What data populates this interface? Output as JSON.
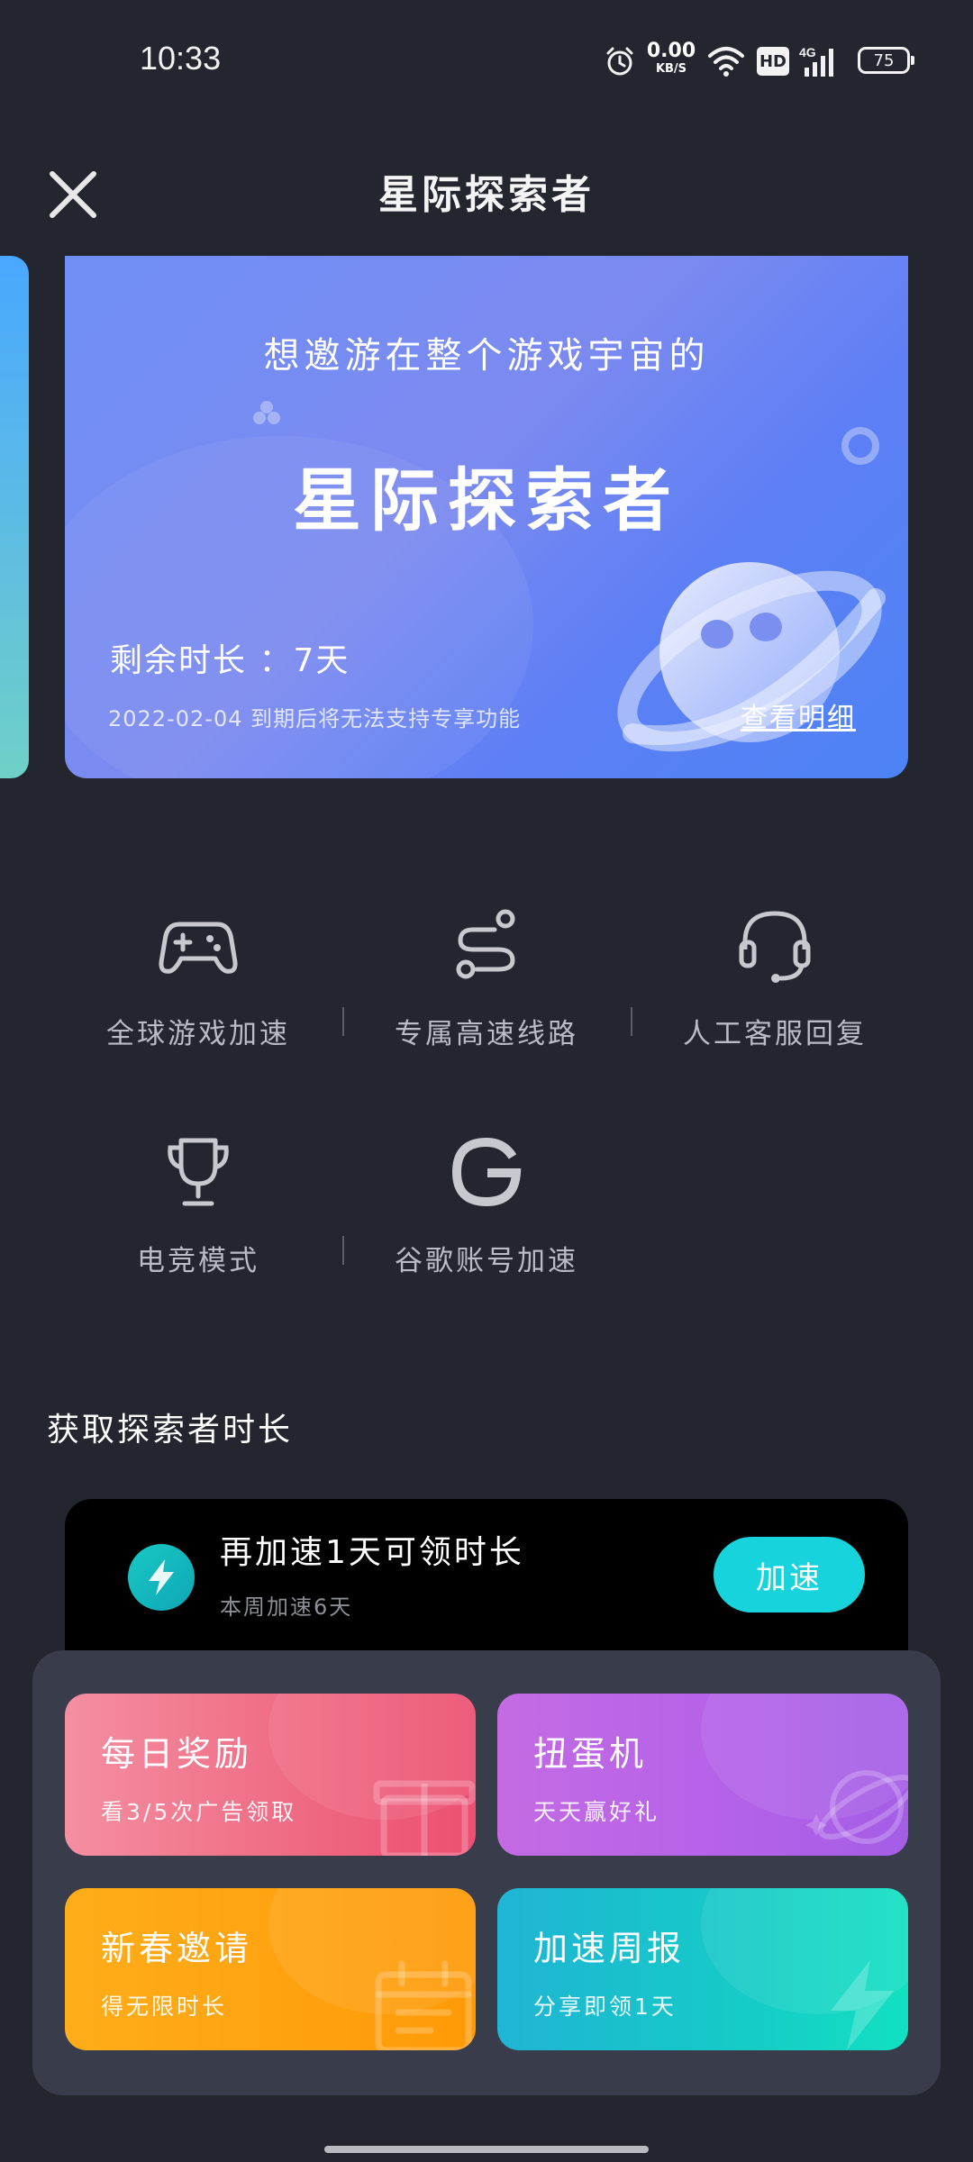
{
  "status_bar": {
    "time": "10:33",
    "net_speed_value": "0.00",
    "net_speed_unit": "KB/S",
    "hd": "HD",
    "signal_label": "4G",
    "battery": "75",
    "icons": [
      "alarm-icon",
      "wifi-icon",
      "hd-icon",
      "signal-icon",
      "battery-icon"
    ]
  },
  "header": {
    "title": "星际探索者",
    "close_icon": "close-icon"
  },
  "hero": {
    "subtitle": "想邀游在整个游戏宇宙的",
    "title": "星际探索者",
    "remaining": "剩余时长 ：7天",
    "expiry_note": "2022-02-04 到期后将无法支持专享功能",
    "detail_link": "查看明细",
    "accent_color": "#6f8ff6"
  },
  "features": [
    {
      "label": "全球游戏加速",
      "icon": "gamepad-icon"
    },
    {
      "label": "专属高速线路",
      "icon": "route-icon"
    },
    {
      "label": "人工客服回复",
      "icon": "headset-icon"
    },
    {
      "label": "电竞模式",
      "icon": "trophy-icon"
    },
    {
      "label": "谷歌账号加速",
      "icon": "google-icon"
    }
  ],
  "section": {
    "heading": "获取探索者时长"
  },
  "accel_banner": {
    "title": "再加速1天可领时长",
    "subtitle": "本周加速6天",
    "button": "加速",
    "icon": "lightning-icon",
    "button_color": "#17d3dc"
  },
  "rewards": [
    {
      "title": "每日奖励",
      "subtitle": "看3/5次广告领取",
      "icon": "gift-icon",
      "color": "#ef6b85"
    },
    {
      "title": "扭蛋机",
      "subtitle": "天天赢好礼",
      "icon": "planet-icon",
      "color": "#b462e8"
    },
    {
      "title": "新春邀请",
      "subtitle": "得无限时长",
      "icon": "calendar-icon",
      "color": "#ffa10f"
    },
    {
      "title": "加速周报",
      "subtitle": "分享即领1天",
      "icon": "lightning-icon",
      "color": "#16c9c8"
    }
  ]
}
